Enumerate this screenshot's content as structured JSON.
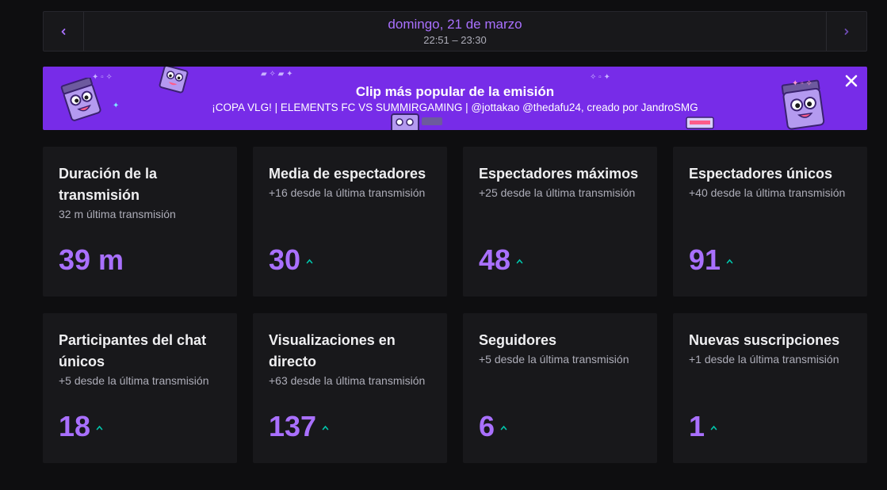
{
  "date_nav": {
    "title": "domingo, 21 de marzo",
    "time_range": "22:51 – 23:30",
    "prev_icon": "chevron-left-icon",
    "next_icon": "chevron-right-icon"
  },
  "banner": {
    "title": "Clip más popular de la emisión",
    "subtitle": "¡COPA VLG! | ELEMENTS FC VS SUMMIRGAMING | @jottakao @thedafu24, creado por JandroSMG",
    "close_icon": "close-icon",
    "background": "#772ce8"
  },
  "colors": {
    "accent": "#a970ff",
    "trend_up": "#00c7ac",
    "card_bg": "#18181b",
    "page_bg": "#0e0e10"
  },
  "stats": [
    {
      "title": "Duración de la transmisión",
      "sub": "32 m última transmisión",
      "value": "39 m",
      "trend": ""
    },
    {
      "title": "Media de espectadores",
      "sub": "+16 desde la última transmisión",
      "value": "30",
      "trend": "up"
    },
    {
      "title": "Espectadores máximos",
      "sub": "+25 desde la última transmisión",
      "value": "48",
      "trend": "up"
    },
    {
      "title": "Espectadores únicos",
      "sub": "+40 desde la última transmisión",
      "value": "91",
      "trend": "up"
    },
    {
      "title": "Participantes del chat únicos",
      "sub": "+5 desde la última transmisión",
      "value": "18",
      "trend": "up"
    },
    {
      "title": "Visualizaciones en directo",
      "sub": "+63 desde la última transmisión",
      "value": "137",
      "trend": "up"
    },
    {
      "title": "Seguidores",
      "sub": "+5 desde la última transmisión",
      "value": "6",
      "trend": "up"
    },
    {
      "title": "Nuevas suscripciones",
      "sub": "+1 desde la última transmisión",
      "value": "1",
      "trend": "up"
    }
  ]
}
